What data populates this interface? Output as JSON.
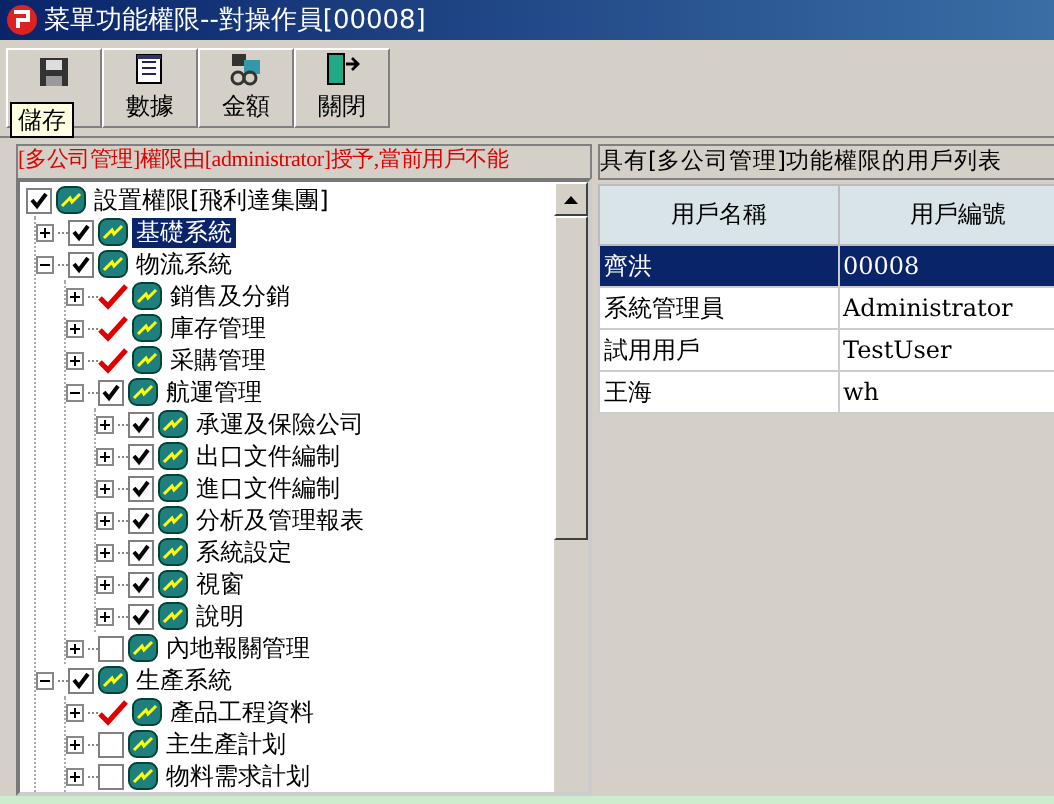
{
  "window": {
    "title": "菜單功能權限--對操作員[00008]"
  },
  "toolbar": [
    {
      "kind": "save"
    },
    {
      "kind": "data",
      "label": "數據"
    },
    {
      "kind": "money",
      "label": "金額"
    },
    {
      "kind": "exit",
      "label": "關閉"
    }
  ],
  "tooltip": "儲存",
  "notice": "[多公司管理]權限由[administrator]授予,當前用戶不能",
  "tree": [
    {
      "label": "設置權限[飛利達集團]",
      "checked": true,
      "partial": false,
      "selected": false,
      "children": [
        {
          "label": "基礎系統",
          "checked": true,
          "partial": false,
          "selected": true,
          "expanded": false
        },
        {
          "label": "物流系統",
          "checked": true,
          "partial": false,
          "selected": false,
          "expanded": true,
          "children": [
            {
              "label": "銷售及分銷",
              "checked": true,
              "partial": true,
              "selected": false,
              "expanded": false
            },
            {
              "label": "庫存管理",
              "checked": true,
              "partial": true,
              "selected": false,
              "expanded": false
            },
            {
              "label": "采購管理",
              "checked": true,
              "partial": true,
              "selected": false,
              "expanded": false
            },
            {
              "label": "航運管理",
              "checked": true,
              "partial": false,
              "selected": false,
              "expanded": true,
              "children": [
                {
                  "label": "承運及保險公司",
                  "checked": true,
                  "partial": false,
                  "selected": false,
                  "expanded": false
                },
                {
                  "label": "出口文件編制",
                  "checked": true,
                  "partial": false,
                  "selected": false,
                  "expanded": false
                },
                {
                  "label": "進口文件編制",
                  "checked": true,
                  "partial": false,
                  "selected": false,
                  "expanded": false
                },
                {
                  "label": "分析及管理報表",
                  "checked": true,
                  "partial": false,
                  "selected": false,
                  "expanded": false
                },
                {
                  "label": "系統設定",
                  "checked": true,
                  "partial": false,
                  "selected": false,
                  "expanded": false
                },
                {
                  "label": "視窗",
                  "checked": true,
                  "partial": false,
                  "selected": false,
                  "expanded": false
                },
                {
                  "label": "說明",
                  "checked": true,
                  "partial": false,
                  "selected": false,
                  "expanded": false
                }
              ]
            },
            {
              "label": "內地報關管理",
              "checked": false,
              "selected": false,
              "expanded": false
            }
          ]
        },
        {
          "label": "生產系統",
          "checked": true,
          "partial": false,
          "selected": false,
          "expanded": true,
          "children": [
            {
              "label": "產品工程資料",
              "checked": true,
              "partial": true,
              "selected": false,
              "expanded": false
            },
            {
              "label": "主生產計划",
              "checked": false,
              "selected": false,
              "expanded": false
            },
            {
              "label": "物料需求計划",
              "checked": false,
              "selected": false,
              "expanded": false
            }
          ]
        }
      ]
    }
  ],
  "user_list": {
    "title": "具有[多公司管理]功能權限的用戶列表",
    "columns": [
      "用戶名稱",
      "用戶編號"
    ],
    "rows": [
      {
        "cells": [
          "齊洪",
          "00008"
        ],
        "selected": true
      },
      {
        "cells": [
          "系統管理員",
          "Administrator"
        ],
        "selected": false
      },
      {
        "cells": [
          "試用用戶",
          "TestUser"
        ],
        "selected": false
      },
      {
        "cells": [
          "王海",
          "wh"
        ],
        "selected": false
      }
    ]
  }
}
